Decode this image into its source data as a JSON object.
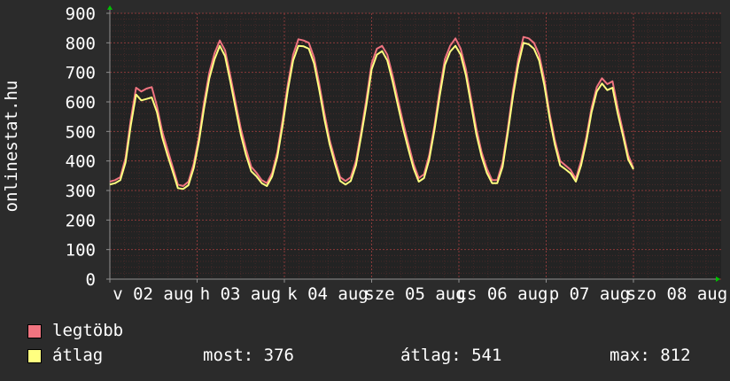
{
  "colors": {
    "background": "#2b2b2b",
    "plot_background": "#232323",
    "grid": "#5a2e2e",
    "axis": "#909090",
    "text": "#ffffff",
    "arrow": "#00c000",
    "max_series": "#f07480",
    "avg_series": "#ffff80"
  },
  "legend": {
    "items": [
      {
        "name": "legtöbb",
        "color": "#f07480"
      },
      {
        "name": "átlag",
        "color": "#ffff80"
      }
    ]
  },
  "stats": {
    "now": "most: 376",
    "avg": "átlag: 541",
    "max": "max: 812"
  },
  "chart_data": {
    "type": "line",
    "title": "",
    "xlabel": "",
    "ylabel": "onlinestat.hu",
    "ylim": [
      0,
      900
    ],
    "yticks": [
      0,
      100,
      200,
      300,
      400,
      500,
      600,
      700,
      800,
      900
    ],
    "xlim": [
      0,
      7
    ],
    "grid": true,
    "xticks": [
      {
        "x": 0,
        "label": "v 02 aug"
      },
      {
        "x": 1,
        "label": "h 03 aug"
      },
      {
        "x": 2,
        "label": "k 04 aug"
      },
      {
        "x": 3,
        "label": "sze 05 aug"
      },
      {
        "x": 4,
        "label": "cs 06 aug"
      },
      {
        "x": 5,
        "label": "p 07 aug"
      },
      {
        "x": 6,
        "label": "szo 08 aug"
      }
    ],
    "series": [
      {
        "name": "legtöbb",
        "color": "#f07480",
        "points": [
          [
            0.0,
            330
          ],
          [
            0.06,
            335
          ],
          [
            0.12,
            345
          ],
          [
            0.18,
            410
          ],
          [
            0.24,
            540
          ],
          [
            0.3,
            648
          ],
          [
            0.36,
            635
          ],
          [
            0.42,
            645
          ],
          [
            0.48,
            650
          ],
          [
            0.54,
            585
          ],
          [
            0.6,
            500
          ],
          [
            0.66,
            440
          ],
          [
            0.72,
            380
          ],
          [
            0.78,
            320
          ],
          [
            0.84,
            315
          ],
          [
            0.9,
            330
          ],
          [
            0.96,
            390
          ],
          [
            1.02,
            480
          ],
          [
            1.08,
            600
          ],
          [
            1.14,
            700
          ],
          [
            1.2,
            765
          ],
          [
            1.26,
            808
          ],
          [
            1.32,
            775
          ],
          [
            1.38,
            690
          ],
          [
            1.44,
            600
          ],
          [
            1.5,
            510
          ],
          [
            1.56,
            440
          ],
          [
            1.62,
            380
          ],
          [
            1.68,
            360
          ],
          [
            1.74,
            335
          ],
          [
            1.8,
            325
          ],
          [
            1.86,
            360
          ],
          [
            1.92,
            430
          ],
          [
            1.98,
            540
          ],
          [
            2.04,
            660
          ],
          [
            2.1,
            760
          ],
          [
            2.16,
            812
          ],
          [
            2.22,
            808
          ],
          [
            2.28,
            800
          ],
          [
            2.34,
            750
          ],
          [
            2.4,
            660
          ],
          [
            2.46,
            560
          ],
          [
            2.52,
            470
          ],
          [
            2.58,
            405
          ],
          [
            2.64,
            345
          ],
          [
            2.7,
            332
          ],
          [
            2.76,
            345
          ],
          [
            2.82,
            400
          ],
          [
            2.88,
            500
          ],
          [
            2.94,
            610
          ],
          [
            3.0,
            730
          ],
          [
            3.06,
            780
          ],
          [
            3.12,
            790
          ],
          [
            3.18,
            760
          ],
          [
            3.24,
            690
          ],
          [
            3.3,
            610
          ],
          [
            3.36,
            530
          ],
          [
            3.42,
            460
          ],
          [
            3.48,
            390
          ],
          [
            3.54,
            342
          ],
          [
            3.6,
            355
          ],
          [
            3.66,
            420
          ],
          [
            3.72,
            520
          ],
          [
            3.78,
            640
          ],
          [
            3.84,
            745
          ],
          [
            3.9,
            790
          ],
          [
            3.96,
            815
          ],
          [
            4.02,
            780
          ],
          [
            4.08,
            710
          ],
          [
            4.14,
            610
          ],
          [
            4.2,
            510
          ],
          [
            4.26,
            430
          ],
          [
            4.32,
            375
          ],
          [
            4.38,
            335
          ],
          [
            4.44,
            335
          ],
          [
            4.5,
            395
          ],
          [
            4.56,
            510
          ],
          [
            4.62,
            640
          ],
          [
            4.68,
            745
          ],
          [
            4.74,
            820
          ],
          [
            4.8,
            815
          ],
          [
            4.86,
            800
          ],
          [
            4.92,
            760
          ],
          [
            4.98,
            675
          ],
          [
            5.04,
            560
          ],
          [
            5.1,
            470
          ],
          [
            5.16,
            400
          ],
          [
            5.22,
            385
          ],
          [
            5.28,
            370
          ],
          [
            5.34,
            340
          ],
          [
            5.4,
            400
          ],
          [
            5.46,
            480
          ],
          [
            5.52,
            580
          ],
          [
            5.58,
            650
          ],
          [
            5.64,
            680
          ],
          [
            5.7,
            660
          ],
          [
            5.76,
            670
          ],
          [
            5.82,
            580
          ],
          [
            5.88,
            500
          ],
          [
            5.94,
            420
          ],
          [
            6.0,
            376
          ]
        ]
      },
      {
        "name": "átlag",
        "color": "#ffff80",
        "points": [
          [
            0.0,
            320
          ],
          [
            0.06,
            325
          ],
          [
            0.12,
            335
          ],
          [
            0.18,
            395
          ],
          [
            0.24,
            520
          ],
          [
            0.3,
            625
          ],
          [
            0.36,
            605
          ],
          [
            0.42,
            610
          ],
          [
            0.48,
            615
          ],
          [
            0.54,
            565
          ],
          [
            0.6,
            480
          ],
          [
            0.66,
            420
          ],
          [
            0.72,
            365
          ],
          [
            0.78,
            308
          ],
          [
            0.84,
            305
          ],
          [
            0.9,
            318
          ],
          [
            0.96,
            375
          ],
          [
            1.02,
            465
          ],
          [
            1.08,
            580
          ],
          [
            1.14,
            680
          ],
          [
            1.2,
            745
          ],
          [
            1.26,
            790
          ],
          [
            1.32,
            755
          ],
          [
            1.38,
            670
          ],
          [
            1.44,
            580
          ],
          [
            1.5,
            490
          ],
          [
            1.56,
            420
          ],
          [
            1.62,
            365
          ],
          [
            1.68,
            348
          ],
          [
            1.74,
            325
          ],
          [
            1.8,
            315
          ],
          [
            1.86,
            348
          ],
          [
            1.92,
            415
          ],
          [
            1.98,
            520
          ],
          [
            2.04,
            640
          ],
          [
            2.1,
            740
          ],
          [
            2.16,
            790
          ],
          [
            2.22,
            788
          ],
          [
            2.28,
            780
          ],
          [
            2.34,
            730
          ],
          [
            2.4,
            640
          ],
          [
            2.46,
            540
          ],
          [
            2.52,
            455
          ],
          [
            2.58,
            390
          ],
          [
            2.64,
            332
          ],
          [
            2.7,
            320
          ],
          [
            2.76,
            332
          ],
          [
            2.82,
            385
          ],
          [
            2.88,
            485
          ],
          [
            2.94,
            590
          ],
          [
            3.0,
            710
          ],
          [
            3.06,
            760
          ],
          [
            3.12,
            772
          ],
          [
            3.18,
            740
          ],
          [
            3.24,
            670
          ],
          [
            3.3,
            590
          ],
          [
            3.36,
            510
          ],
          [
            3.42,
            440
          ],
          [
            3.48,
            375
          ],
          [
            3.54,
            330
          ],
          [
            3.6,
            342
          ],
          [
            3.66,
            405
          ],
          [
            3.72,
            505
          ],
          [
            3.78,
            620
          ],
          [
            3.84,
            725
          ],
          [
            3.9,
            770
          ],
          [
            3.96,
            790
          ],
          [
            4.02,
            760
          ],
          [
            4.08,
            690
          ],
          [
            4.14,
            590
          ],
          [
            4.2,
            490
          ],
          [
            4.26,
            415
          ],
          [
            4.32,
            360
          ],
          [
            4.38,
            325
          ],
          [
            4.44,
            325
          ],
          [
            4.5,
            380
          ],
          [
            4.56,
            495
          ],
          [
            4.62,
            620
          ],
          [
            4.68,
            725
          ],
          [
            4.74,
            800
          ],
          [
            4.8,
            795
          ],
          [
            4.86,
            780
          ],
          [
            4.92,
            740
          ],
          [
            4.98,
            655
          ],
          [
            5.04,
            545
          ],
          [
            5.1,
            455
          ],
          [
            5.16,
            385
          ],
          [
            5.22,
            372
          ],
          [
            5.28,
            358
          ],
          [
            5.34,
            330
          ],
          [
            5.4,
            385
          ],
          [
            5.46,
            465
          ],
          [
            5.52,
            565
          ],
          [
            5.58,
            635
          ],
          [
            5.64,
            662
          ],
          [
            5.7,
            640
          ],
          [
            5.76,
            648
          ],
          [
            5.82,
            560
          ],
          [
            5.88,
            485
          ],
          [
            5.94,
            405
          ],
          [
            6.0,
            372
          ]
        ]
      }
    ]
  }
}
